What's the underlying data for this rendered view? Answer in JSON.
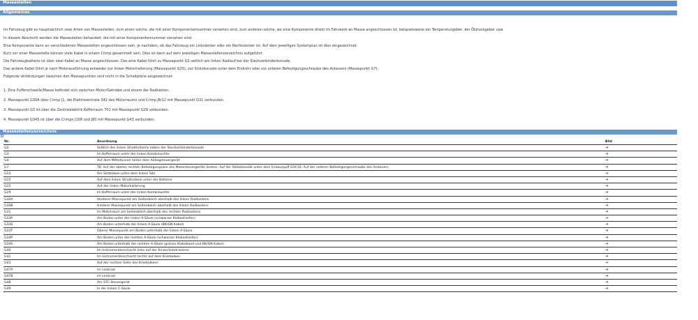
{
  "title": "Massestellen",
  "section_general": "Allgemeines",
  "intro": [
    "Im Fahrzeug gibt es hauptsächlich zwei Arten von Massestellen: zum einen solche, die mit einer Komponentennummer versehen sind, zum anderen solche, wo eine Komponente direkt im Fahrwerk an Masse angeschlossen ist, beispielsweise ein Temperaturgeber, der Öldruckgeber usw.",
    "In diesem Abschnitt werden die Massestellen behandelt, die mit einer Komponentennummer versehen sind.",
    "Eine Komponente kann an verschiedenen Massestellen angeschlossen sein, je nachdem, ob das Fahrzeug ein Linkslenker oder ein Rechtslenker ist. Auf dem jeweiligen Systemplan ist dies eingezeichnet.",
    "Kurz vor einer Massestelle können viele Kabel in einem Crimp gesammelt sein. Dies ist dann auf dem jeweiligen Massestellenverzeichnis aufgeführt.",
    "Die Fahrzeugbatterie ist über zwei Kabel an Masse angeschlossen. Das eine Kabel führt zu Massepunkt G2 seitlich am linken Radlauf bei der Steckverbinderkonsole.",
    "Das andere Kabel führt je nach Motorausführung entweder zur linken Motorhalterung (Massepunkt G25), zur Stützkonsole unter dem Endrohr oder zur unteren Befestigungsschraube des Anlassers (Massepunkt G7).",
    "Folgende Verbindungen zwischen den Massepunkten sind nicht in die Schaltpläne eingezeichnet:"
  ],
  "numbered": [
    "1.  Eine Pufferschwelle/Masse befindet sich zwischen Motor/Getriebe und einem der Radkästen.",
    "2.  Massepunkt G30A über Crimp J1, die Elektrozentrale 342 des Motorraums und Crimp J8/12 mit Massepunkt G31 verbunden.",
    "3.  Massepunkt G3 ist über die Zentralelektrik Kofferraum 701 mit Massepunkt G29 verbunden.",
    "4.  Massepunkt G34S ist über die Crimps J108 und J80 mit Massepunkt G43 verbunden."
  ],
  "section_list": "Massestellenverzeichnis",
  "table": {
    "headers": {
      "nr": "Nr.",
      "ord": "Anordnung",
      "bild": "Bild"
    },
    "arrow": "➜",
    "rows": [
      {
        "nr": "G2",
        "ord": "Seitlich des linken Strukturbeins neben der Steckverbinderkonsole"
      },
      {
        "nr": "G3",
        "ord": "Im Kofferraum unter der linken Kombileuchte"
      },
      {
        "nr": "G4",
        "ord": "Auf dem Mitteltunnel hinter dem Airbagsteuergerät"
      },
      {
        "nr": "G7",
        "ord": "T8: Auf der oberen rechten Befestigungsöse des Motorsteuergeräts Simtec: Auf der Stützkonsole unter dem Endauspuff EDC16: Auf der unteren Befestigungsschraube des Anlassers"
      },
      {
        "nr": "G14",
        "ord": "Am Sitzbalken unter dem linken Sitz"
      },
      {
        "nr": "G15",
        "ord": "Auf dem linken Strukturbein unter der Batterie"
      },
      {
        "nr": "G25",
        "ord": "Auf der linken Motorhalterung"
      },
      {
        "nr": "G29",
        "ord": "Im Kofferraum unter der linken Kombileuchte"
      },
      {
        "nr": "G30A",
        "ord": "Vorderer Massepunkt am Seitenblech oberhalb des linken Radkastens"
      },
      {
        "nr": "G30B",
        "ord": "Hinterer Massepunkt am Seitenblech oberhalb des linken Radkastens"
      },
      {
        "nr": "G31",
        "ord": "Im Motorraum am Seitenblech oberhalb des rechten Radkastens"
      },
      {
        "nr": "G33P",
        "ord": "Am Boden unter der linken A-Säule (schwarzer Klebestreifen)"
      },
      {
        "nr": "G33S",
        "ord": "Am Boden unterhalb der linken A-Säule (BK/GN Kabel)"
      },
      {
        "nr": "G33T",
        "ord": "Oberer Massepunkt am Boden unterhalb der linken A-Säule"
      },
      {
        "nr": "G34P",
        "ord": "Am Boden unter der rechten A-Säule (schwarzer Klebestreifen)"
      },
      {
        "nr": "G34S",
        "ord": "Am Boden unterhalb der rechten A-Säule (grünes Klebeband und BK/GN Kabel)"
      },
      {
        "nr": "G40",
        "ord": "Im Instrumentenschacht links auf der Knieschutztraverse"
      },
      {
        "nr": "G41",
        "ord": "Im Instrumentenschacht rechts auf dem Kniebalken"
      },
      {
        "nr": "G43",
        "ord": "Auf der rechten Seite des Kniebalkens"
      },
      {
        "nr": "G47A",
        "ord": "im Lenkrad"
      },
      {
        "nr": "G47B",
        "ord": "im Lenkrad"
      },
      {
        "nr": "G48",
        "ord": "Am STC-Steuergerät"
      },
      {
        "nr": "G49",
        "ord": "In der linken C-Säule"
      }
    ]
  }
}
